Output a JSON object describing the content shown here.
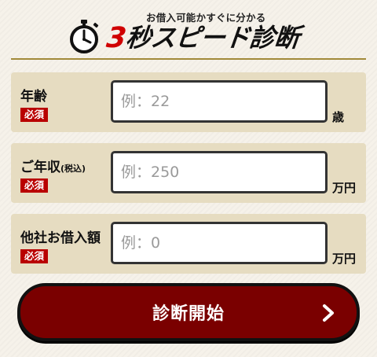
{
  "header": {
    "subtitle": "お借入可能かすぐに分かる",
    "title_number": "3",
    "title_rest": "秒スピード診断",
    "icon": "stopwatch-icon",
    "accent_color": "#d00000"
  },
  "form": {
    "fields": [
      {
        "label": "年齢",
        "label_suffix": "",
        "required_badge": "必須",
        "placeholder": "例：22",
        "value": "",
        "unit": "歳"
      },
      {
        "label": "ご年収",
        "label_suffix": "(税込)",
        "required_badge": "必須",
        "placeholder": "例：250",
        "value": "",
        "unit": "万円"
      },
      {
        "label": "他社お借入額",
        "label_suffix": "",
        "required_badge": "必須",
        "placeholder": "例：0",
        "value": "",
        "unit": "万円"
      }
    ]
  },
  "cta": {
    "label": "診断開始",
    "icon": "chevron-right-icon",
    "background_color": "#7a0000"
  }
}
